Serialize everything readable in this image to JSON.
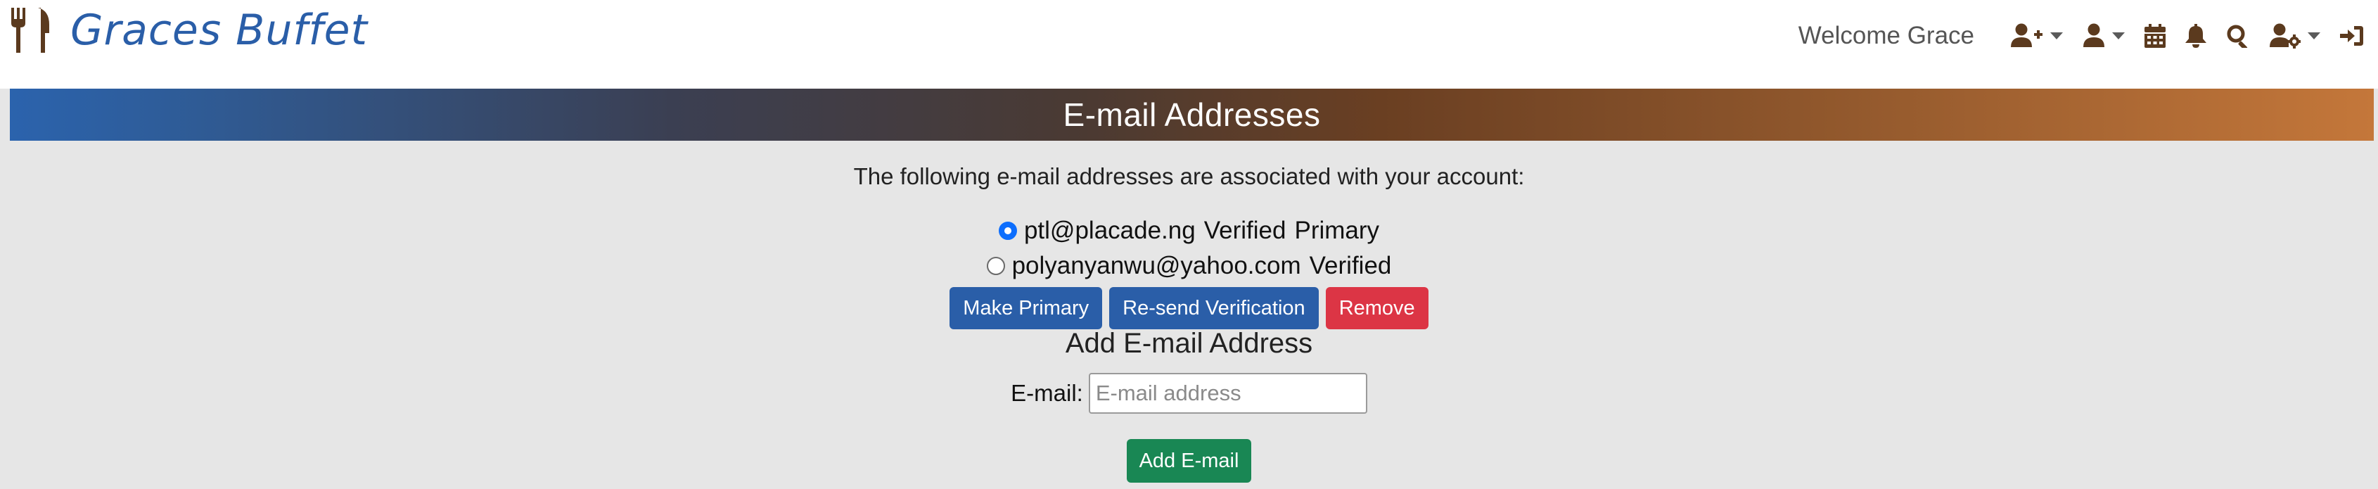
{
  "header": {
    "brand": "Graces Buffet",
    "welcome": "Welcome Grace",
    "icons": [
      "fork-knife-icon",
      "user-plus-icon",
      "user-icon",
      "calendar-icon",
      "bell-icon",
      "search-icon",
      "user-gear-icon",
      "sign-in-icon"
    ]
  },
  "page": {
    "title": "E-mail Addresses",
    "intro": "The following e-mail addresses are associated with your account:"
  },
  "emails": [
    {
      "address": "ptl@placade.ng",
      "status": "Verified",
      "primary_label": "Primary",
      "selected": true
    },
    {
      "address": "polyanyanwu@yahoo.com",
      "status": "Verified",
      "primary_label": "",
      "selected": false
    }
  ],
  "actions": {
    "make_primary": "Make Primary",
    "resend": "Re-send Verification",
    "remove": "Remove"
  },
  "add_form": {
    "title": "Add E-mail Address",
    "label": "E-mail:",
    "placeholder": "E-mail address",
    "value": "",
    "submit": "Add E-mail"
  },
  "colors": {
    "brand_blue": "#2a5ea8",
    "danger_red": "#dc3545",
    "success_green": "#198754",
    "icon_brown": "#5b3a1e",
    "content_gray": "#e6e6e6"
  }
}
